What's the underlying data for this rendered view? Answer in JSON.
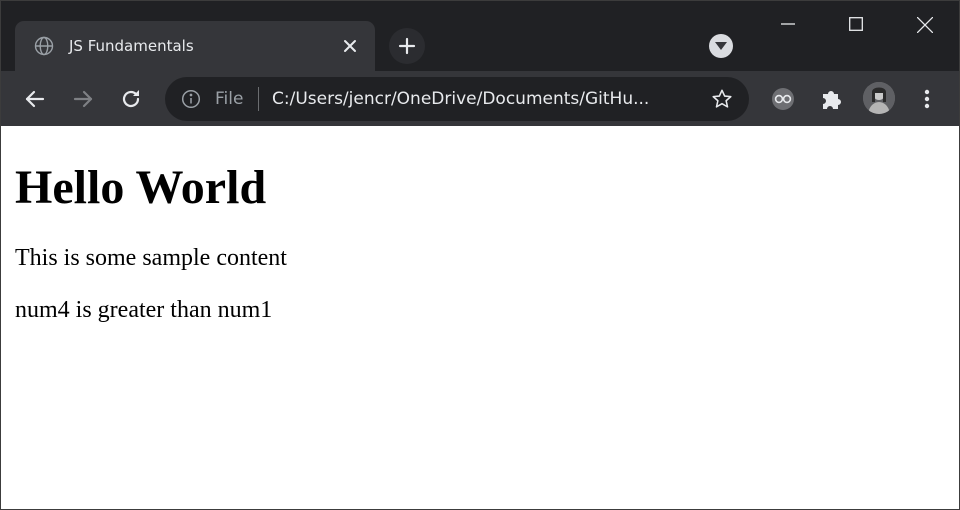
{
  "browser": {
    "tab": {
      "title": "JS Fundamentals"
    },
    "omnibox": {
      "scheme_label": "File",
      "url": "C:/Users/jencr/OneDrive/Documents/GitHu..."
    },
    "icons": {
      "favicon": "globe-icon",
      "tab_close": "close-icon",
      "new_tab": "plus-icon",
      "tab_search": "chevron-down-icon",
      "minimize": "minimize-icon",
      "maximize": "maximize-icon",
      "window_close": "close-icon",
      "back": "arrow-left-icon",
      "forward": "arrow-right-icon",
      "reload": "reload-icon",
      "site_info": "info-icon",
      "bookmark": "star-icon",
      "extension": "extension-icon",
      "extensions_menu": "puzzle-icon",
      "profile": "avatar",
      "menu": "kebab-menu-icon"
    },
    "colors": {
      "frame": "#202124",
      "toolbar": "#35363a",
      "omnibox": "#202124",
      "text": "#e8eaed",
      "muted": "#9aa0a6"
    }
  },
  "page": {
    "heading": "Hello World",
    "paragraphs": [
      "This is some sample content",
      "num4 is greater than num1"
    ]
  }
}
